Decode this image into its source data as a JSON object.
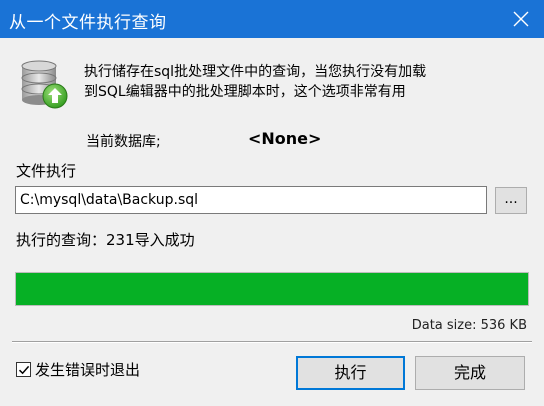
{
  "window": {
    "title": "从一个文件执行查询",
    "close_icon": "close-icon"
  },
  "description": {
    "line1": "执行储存在sql批处理文件中的查询，当您执行没有加载",
    "line2": "到SQL编辑器中的批处理脚本时，这个选项非常有用"
  },
  "database": {
    "label": "当前数据库;",
    "value": "<None>"
  },
  "file": {
    "label": "文件执行",
    "path": "C:\\mysql\\data\\Backup.sql",
    "browse_label": "..."
  },
  "execution": {
    "status_text": "执行的查询：231导入成功",
    "progress_fraction": 1.0,
    "data_size": "Data size: 536 KB"
  },
  "colors": {
    "titlebar": "#1a73d6",
    "progress": "#06b025",
    "default_button_border": "#0078d7"
  },
  "options": {
    "exit_on_error_label": "发生错误时退出",
    "exit_on_error_checked": true
  },
  "buttons": {
    "execute_label": "执行",
    "done_label": "完成"
  }
}
